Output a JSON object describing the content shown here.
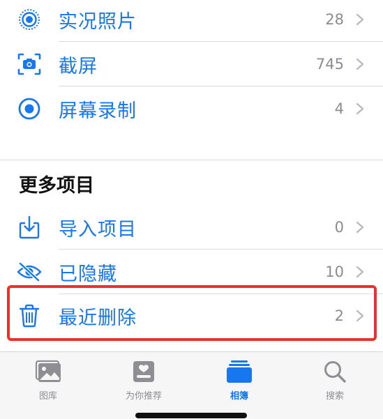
{
  "media_types": [
    {
      "label": "实况照片",
      "count": "28",
      "icon": "live-photo-icon"
    },
    {
      "label": "截屏",
      "count": "745",
      "icon": "screenshot-icon"
    },
    {
      "label": "屏幕录制",
      "count": "4",
      "icon": "screen-recording-icon"
    }
  ],
  "more": {
    "title": "更多项目",
    "items": [
      {
        "label": "导入项目",
        "count": "0",
        "icon": "import-icon"
      },
      {
        "label": "已隐藏",
        "count": "10",
        "icon": "hidden-eye-icon"
      },
      {
        "label": "最近删除",
        "count": "2",
        "icon": "trash-icon"
      }
    ]
  },
  "tabbar": {
    "tabs": [
      {
        "label": "图库",
        "icon": "photo-library-icon",
        "active": false
      },
      {
        "label": "为你推荐",
        "icon": "for-you-icon",
        "active": false
      },
      {
        "label": "相簿",
        "icon": "albums-icon",
        "active": true
      },
      {
        "label": "搜索",
        "icon": "search-icon",
        "active": false
      }
    ]
  },
  "colors": {
    "accent": "#1677f0",
    "highlight": "#ee2f2f",
    "muted": "#8e8e93"
  }
}
